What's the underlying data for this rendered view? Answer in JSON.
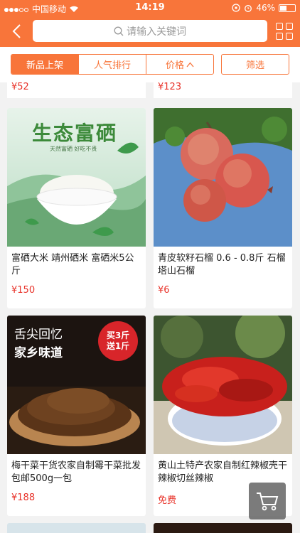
{
  "status_bar": {
    "carrier": "中国移动",
    "time": "14:19",
    "battery": "46%"
  },
  "nav": {
    "search_placeholder": "请输入关键词"
  },
  "filters": {
    "tabs": [
      {
        "label": "新品上架",
        "active": true
      },
      {
        "label": "人气排行",
        "active": false
      },
      {
        "label": "价格",
        "active": false
      }
    ],
    "filter_label": "筛选"
  },
  "top_prices": [
    "¥52",
    "¥123"
  ],
  "products": [
    {
      "title": "富硒大米 靖州硒米 富硒米5公斤",
      "price": "¥150",
      "image_text": "生态富硒",
      "image_subtext": "天然富硒  好吃不贵"
    },
    {
      "title": "青皮软籽石榴 0.6 - 0.8斤 石榴 塔山石榴",
      "price": "¥6"
    },
    {
      "title": "梅干菜干货农家自制霉干菜批发包邮500g一包",
      "price": "¥188",
      "image_text_1": "舌尖回忆",
      "image_text_2": "家乡味道",
      "badge_line_1": "买3斤",
      "badge_line_2": "送1斤"
    },
    {
      "title": "黄山土特产农家自制红辣椒壳干辣椒切丝辣椒",
      "price": "免费"
    }
  ],
  "colors": {
    "brand": "#f8753a",
    "price": "#e8332a"
  }
}
